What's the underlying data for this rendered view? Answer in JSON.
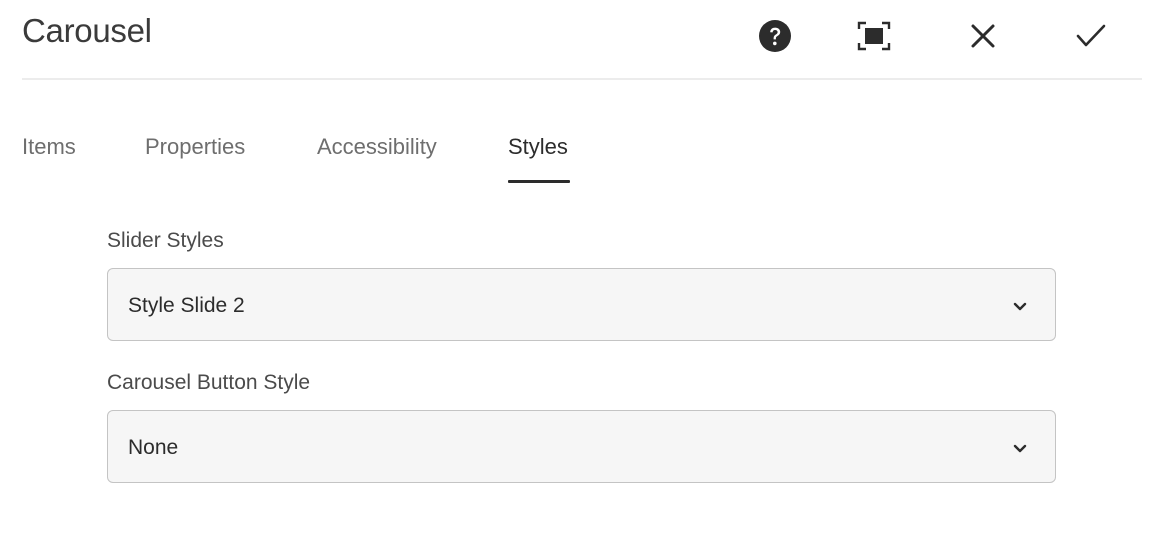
{
  "dialog": {
    "title": "Carousel",
    "actions": {
      "help_icon": "help-icon",
      "fullscreen_icon": "fullscreen-icon",
      "close_icon": "close-icon",
      "done_icon": "checkmark-icon"
    }
  },
  "tabs": [
    {
      "label": "Items",
      "selected": false
    },
    {
      "label": "Properties",
      "selected": false
    },
    {
      "label": "Accessibility",
      "selected": false
    },
    {
      "label": "Styles",
      "selected": true
    }
  ],
  "fields": {
    "slider_styles": {
      "label": "Slider Styles",
      "value": "Style Slide 2"
    },
    "carousel_button_style": {
      "label": "Carousel Button Style",
      "value": "None"
    }
  },
  "colors": {
    "text": "#2c2c2c",
    "muted_text": "#6e6e6e",
    "field_border": "#c4c4c4",
    "field_background": "#f6f6f6",
    "divider": "#ececec"
  }
}
